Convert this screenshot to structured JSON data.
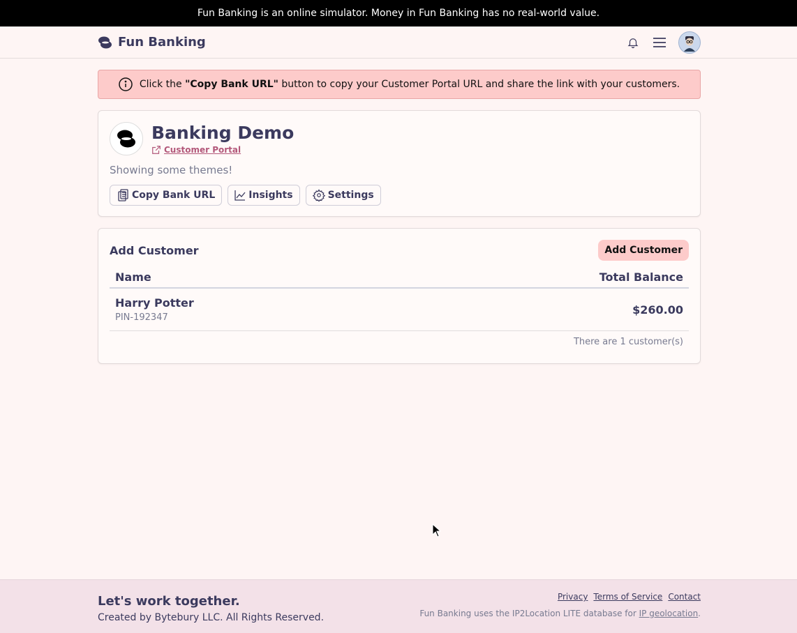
{
  "top_banner": "Fun Banking is an online simulator. Money in Fun Banking has no real-world value.",
  "navbar": {
    "brand": "Fun Banking",
    "icons": [
      "bell-icon",
      "menu-icon",
      "avatar"
    ]
  },
  "alert": {
    "prefix": "Click the ",
    "bold": "\"Copy Bank URL\"",
    "suffix": " button to copy your Customer Portal URL and share the link with your customers."
  },
  "bank": {
    "title": "Banking Demo",
    "portal_link": "Customer Portal",
    "subtitle": "Showing some themes!",
    "buttons": {
      "copy": "Copy Bank URL",
      "insights": "Insights",
      "settings": "Settings"
    }
  },
  "customers": {
    "title": "Add Customer",
    "add_button": "Add Customer",
    "columns": {
      "name": "Name",
      "balance": "Total Balance"
    },
    "rows": [
      {
        "name": "Harry Potter",
        "pin": "PIN-192347",
        "balance": "$260.00"
      }
    ],
    "count_text": "There are 1 customer(s)"
  },
  "footer": {
    "title": "Let's work together.",
    "subtitle": "Created by Bytebury LLC. All Rights Reserved.",
    "links": [
      "Privacy",
      "Terms of Service",
      "Contact"
    ],
    "geo_prefix": "Fun Banking uses the IP2Location LITE database for ",
    "geo_link": "IP geolocation",
    "geo_suffix": "."
  },
  "colors": {
    "accent": "#fdcbca",
    "text": "#3b3a5e",
    "link": "#b3587a",
    "background": "#fef5f4",
    "footer_bg": "#f3e1e8"
  }
}
